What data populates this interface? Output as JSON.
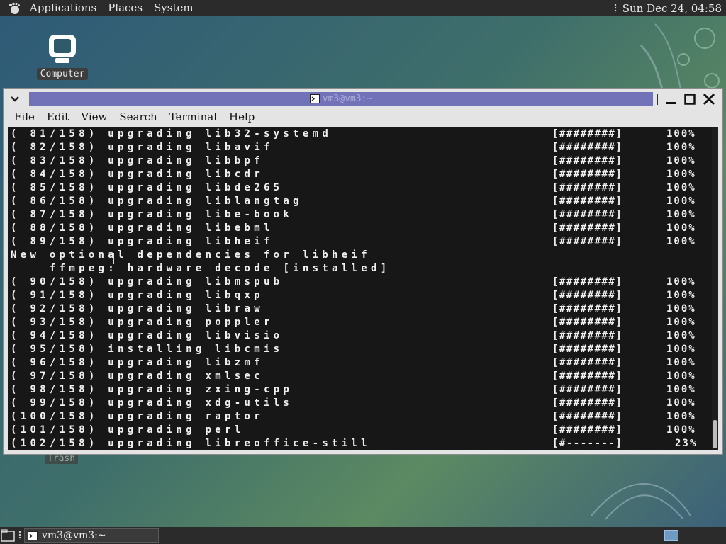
{
  "top_panel": {
    "menus": [
      "Applications",
      "Places",
      "System"
    ],
    "clock": "Sun Dec 24, 04:58"
  },
  "desktop": {
    "computer_label": "Computer",
    "trash_label": "Trash"
  },
  "window": {
    "title": "vm3@vm3:~",
    "menu": [
      "File",
      "Edit",
      "View",
      "Search",
      "Terminal",
      "Help"
    ]
  },
  "terminal": {
    "lines": [
      {
        "text": "( 81/158) upgrading lib32-systemd",
        "bar": "[########]",
        "pct": "100%"
      },
      {
        "text": "( 82/158) upgrading libavif",
        "bar": "[########]",
        "pct": "100%"
      },
      {
        "text": "( 83/158) upgrading libbpf",
        "bar": "[########]",
        "pct": "100%"
      },
      {
        "text": "( 84/158) upgrading libcdr",
        "bar": "[########]",
        "pct": "100%"
      },
      {
        "text": "( 85/158) upgrading libde265",
        "bar": "[########]",
        "pct": "100%"
      },
      {
        "text": "( 86/158) upgrading liblangtag",
        "bar": "[########]",
        "pct": "100%"
      },
      {
        "text": "( 87/158) upgrading libe-book",
        "bar": "[########]",
        "pct": "100%"
      },
      {
        "text": "( 88/158) upgrading libebml",
        "bar": "[########]",
        "pct": "100%"
      },
      {
        "text": "( 89/158) upgrading libheif",
        "bar": "[########]",
        "pct": "100%"
      },
      {
        "text": "New optional dependencies for libheif",
        "bar": "",
        "pct": ""
      },
      {
        "text": "    ffmpeg: hardware decode [installed]",
        "bar": "",
        "pct": ""
      },
      {
        "text": "( 90/158) upgrading libmspub",
        "bar": "[########]",
        "pct": "100%"
      },
      {
        "text": "( 91/158) upgrading libqxp",
        "bar": "[########]",
        "pct": "100%"
      },
      {
        "text": "( 92/158) upgrading libraw",
        "bar": "[########]",
        "pct": "100%"
      },
      {
        "text": "( 93/158) upgrading poppler",
        "bar": "[########]",
        "pct": "100%"
      },
      {
        "text": "( 94/158) upgrading libvisio",
        "bar": "[########]",
        "pct": "100%"
      },
      {
        "text": "( 95/158) installing libcmis",
        "bar": "[########]",
        "pct": "100%"
      },
      {
        "text": "( 96/158) upgrading libzmf",
        "bar": "[########]",
        "pct": "100%"
      },
      {
        "text": "( 97/158) upgrading xmlsec",
        "bar": "[########]",
        "pct": "100%"
      },
      {
        "text": "( 98/158) upgrading zxing-cpp",
        "bar": "[########]",
        "pct": "100%"
      },
      {
        "text": "( 99/158) upgrading xdg-utils",
        "bar": "[########]",
        "pct": "100%"
      },
      {
        "text": "(100/158) upgrading raptor",
        "bar": "[########]",
        "pct": "100%"
      },
      {
        "text": "(101/158) upgrading perl",
        "bar": "[########]",
        "pct": "100%"
      },
      {
        "text": "(102/158) upgrading libreoffice-still",
        "bar": "[#-------]",
        "pct": "23%"
      }
    ]
  },
  "taskbar": {
    "window_button": "vm3@vm3:~"
  }
}
